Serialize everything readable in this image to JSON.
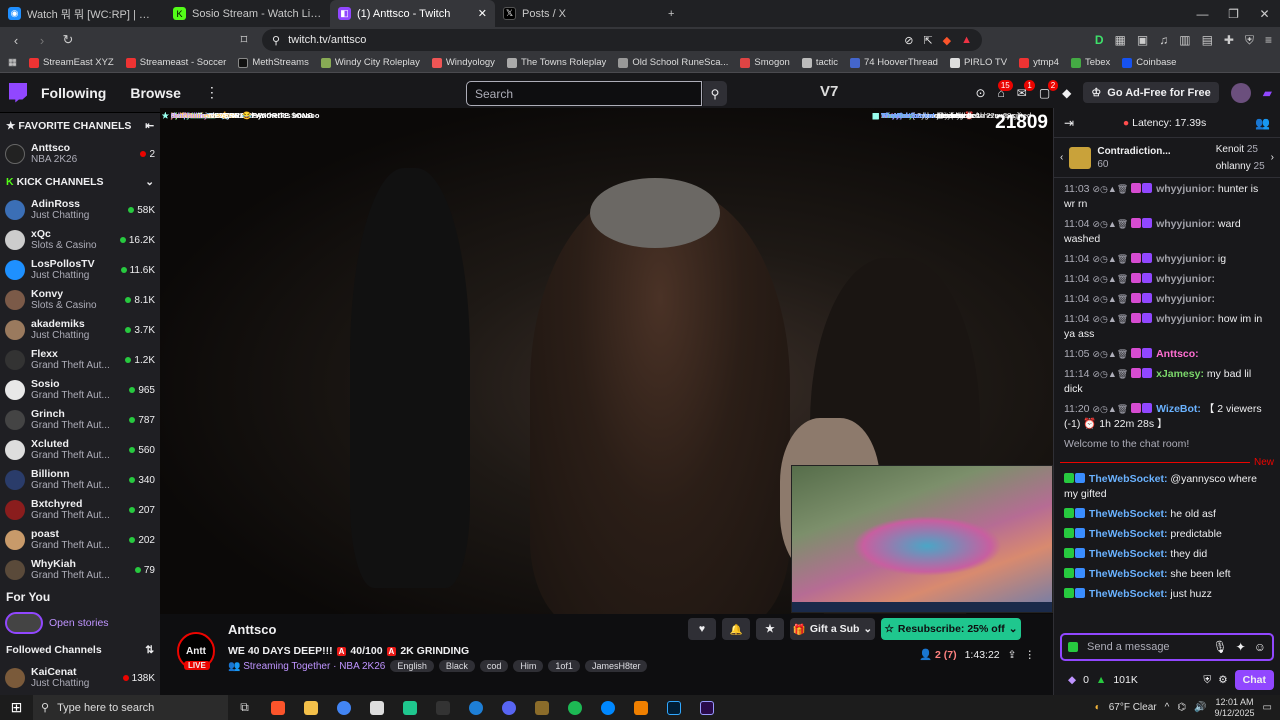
{
  "browser": {
    "tabs": [
      {
        "title": "Watch 뭐 뭐 [WC:RP] | Streamable",
        "color": "#1f8fff"
      },
      {
        "title": "Sosio Stream - Watch Live on Kick",
        "color": "#53fc18"
      },
      {
        "title": "(1) Anttsco - Twitch",
        "color": "#9147ff"
      },
      {
        "title": "Posts / X",
        "color": "#000000"
      }
    ],
    "url": "twitch.tv/anttsco",
    "bookmarks": [
      "StreamEast XYZ",
      "Streameast - Soccer",
      "MethStreams",
      "Windy City Roleplay",
      "Windyology",
      "The Towns Roleplay",
      "Old School RuneSca...",
      "Smogon",
      "tactic",
      "74 HooverThread",
      "PIRLO TV",
      "ytmp4",
      "Tebex",
      "Coinbase"
    ]
  },
  "twitch": {
    "nav": {
      "following": "Following",
      "browse": "Browse",
      "search_placeholder": "Search",
      "adfree": "Go Ad-Free for Free",
      "badge_1": "15",
      "badge_2": "1",
      "badge_3": "2"
    },
    "sidebar": {
      "favorite_header": "FAVORITE CHANNELS",
      "favorites": [
        {
          "name": "Anttsco",
          "game": "NBA 2K26",
          "viewers": "2"
        }
      ],
      "kick_header": "KICK CHANNELS",
      "kick": [
        {
          "name": "AdinRoss",
          "game": "Just Chatting",
          "viewers": "58K",
          "color": "#3b6fb6"
        },
        {
          "name": "xQc",
          "game": "Slots & Casino",
          "viewers": "16.2K",
          "color": "#cccccc"
        },
        {
          "name": "LosPollosTV",
          "game": "Just Chatting",
          "viewers": "11.6K",
          "color": "#1e90ff"
        },
        {
          "name": "Konvy",
          "game": "Slots & Casino",
          "viewers": "8.1K",
          "color": "#7b5a48"
        },
        {
          "name": "akademiks",
          "game": "Just Chatting",
          "viewers": "3.7K",
          "color": "#9a7a5e"
        },
        {
          "name": "Flexx",
          "game": "Grand Theft Aut...",
          "viewers": "1.2K",
          "color": "#333333"
        },
        {
          "name": "Sosio",
          "game": "Grand Theft Aut...",
          "viewers": "965",
          "color": "#e8e8e8"
        },
        {
          "name": "Grinch",
          "game": "Grand Theft Aut...",
          "viewers": "787",
          "color": "#444444"
        },
        {
          "name": "Xcluted",
          "game": "Grand Theft Aut...",
          "viewers": "560",
          "color": "#dddddd"
        },
        {
          "name": "Billionn",
          "game": "Grand Theft Aut...",
          "viewers": "340",
          "color": "#2a3c6a"
        },
        {
          "name": "Bxtchyred",
          "game": "Grand Theft Aut...",
          "viewers": "207",
          "color": "#8a1d1d"
        },
        {
          "name": "poast",
          "game": "Grand Theft Aut...",
          "viewers": "202",
          "color": "#c89a6a"
        },
        {
          "name": "WhyKiah",
          "game": "Grand Theft Aut...",
          "viewers": "79",
          "color": "#5a4a3a"
        }
      ],
      "for_you": "For You",
      "open_stories": "Open stories",
      "followed_header": "Followed Channels",
      "followed": [
        {
          "name": "KaiCenat",
          "game": "Just Chatting",
          "viewers": "138K"
        }
      ]
    },
    "video": {
      "counter": "21809",
      "overlay_left": [
        {
          "user": "kkspinnin22:",
          "text": "DESHAE FAVORITE SONG",
          "color": "#8ad3ff"
        },
        {
          "user": "cashmonyr:",
          "text": "AYYYYYYYYY",
          "color": "#ff6bd6"
        },
        {
          "user": "slatty______:",
          "text": "🙏",
          "color": "#8affc7"
        },
        {
          "user": "RealestDonn:",
          "text": "@naturalsynthetics lmaooo",
          "color": "#ffffff"
        },
        {
          "user": "jut717:",
          "text": "",
          "color": "#ff9b9b"
        },
        {
          "user": "djsn1000:",
          "text": "",
          "color": "#a2ff8a"
        },
        {
          "user": "dariusrebirth:",
          "text": "Ayo",
          "color": "#ffffff"
        },
        {
          "user": "bellamarieeeeeee:",
          "text": "",
          "color": "#ffd36b"
        },
        {
          "user": "tbhchillin:",
          "text": "NEVERR 😂",
          "color": "#c49cff"
        }
      ],
      "overlay_right": [
        {
          "user": "whyyjunior",
          "text": "ig",
          "color": "#8a8af0"
        },
        {
          "user": "whyyjunior",
          "text": "",
          "color": "#8a8af0"
        },
        {
          "user": "whyyjunior",
          "text": "how im in ya ass",
          "color": "#8a8af0"
        },
        {
          "user": "Anttsco",
          "text": "",
          "color": "#ff6ed2"
        },
        {
          "user": "xJamesy",
          "text": "my bad lil dick",
          "color": "#7ad66a"
        },
        {
          "user": "WizeBot",
          "text": "[ 2 viewers (-1) ⏰ 1h 22m 28s ]",
          "color": "#6ab2ff"
        },
        {
          "user": "TheWebSocket",
          "text": "@yannysco where my gifted",
          "color": "#7aa8ff"
        },
        {
          "user": "TheWebSocket",
          "text": "he old asf",
          "color": "#7aa8ff"
        },
        {
          "user": "TheWebSocket",
          "text": "predictable",
          "color": "#7aa8ff"
        },
        {
          "user": "TheWebSocket",
          "text": "they did",
          "color": "#7aa8ff"
        },
        {
          "user": "TheWebSocket",
          "text": "she been left",
          "color": "#7aa8ff"
        },
        {
          "user": "TheWebSocket",
          "text": "just huzz",
          "color": "#7aa8ff"
        }
      ]
    },
    "stream": {
      "channel": "Anttsco",
      "live": "LIVE",
      "title_a": "WE 40 DAYS DEEP!!!",
      "title_b": "40/100",
      "title_c": "2K GRINDING",
      "streaming_together": "Streaming Together · NBA 2K26",
      "tags": [
        "English",
        "Black",
        "cod",
        "Him",
        "1of1",
        "JamesH8ter"
      ],
      "gift": "Gift a Sub",
      "resub": "Resubscribe: 25% off",
      "viewers": "2 (7)",
      "uptime": "1:43:22"
    },
    "chat": {
      "latency": "Latency: 17.39s",
      "hype_title": "Contradiction...",
      "hype_count": "60",
      "top1_name": "Kenoit",
      "top1_count": "25",
      "top2_name": "ohlanny",
      "top2_count": "25",
      "messages": [
        {
          "time": "11:03",
          "user": "whyyjunior:",
          "text": "hunter is wr rn",
          "color": "#a0a0a8"
        },
        {
          "time": "11:04",
          "user": "whyyjunior:",
          "text": "ward washed",
          "color": "#a0a0a8"
        },
        {
          "time": "11:04",
          "user": "whyyjunior:",
          "text": "ig",
          "color": "#a0a0a8"
        },
        {
          "time": "11:04",
          "user": "whyyjunior:",
          "text": "",
          "color": "#a0a0a8"
        },
        {
          "time": "11:04",
          "user": "whyyjunior:",
          "text": "",
          "color": "#a0a0a8"
        },
        {
          "time": "11:04",
          "user": "whyyjunior:",
          "text": "how im in ya ass",
          "color": "#a0a0a8"
        },
        {
          "time": "11:05",
          "user": "Anttsco:",
          "text": "",
          "color": "#ff6ed2"
        },
        {
          "time": "11:14",
          "user": "xJamesy:",
          "text": "my bad lil dick",
          "color": "#7ad66a"
        },
        {
          "time": "11:20",
          "user": "WizeBot:",
          "text": "【 2 viewers (-1) ⏰ 1h 22m 28s 】",
          "color": "#6ab2ff"
        }
      ],
      "welcome": "Welcome to the chat room!",
      "new_label": "New",
      "new_messages": [
        {
          "user": "TheWebSocket:",
          "text": "@yannysco where my gifted"
        },
        {
          "user": "TheWebSocket:",
          "text": "he old asf"
        },
        {
          "user": "TheWebSocket:",
          "text": "predictable"
        },
        {
          "user": "TheWebSocket:",
          "text": "they did"
        },
        {
          "user": "TheWebSocket:",
          "text": "she been left"
        },
        {
          "user": "TheWebSocket:",
          "text": "just huzz"
        }
      ],
      "input_placeholder": "Send a message",
      "points_a": "0",
      "points_b": "101K",
      "chat_button": "Chat"
    }
  },
  "taskbar": {
    "search_placeholder": "Type here to search",
    "weather": "67°F  Clear",
    "time": "12:01 AM",
    "date": "9/12/2025"
  }
}
